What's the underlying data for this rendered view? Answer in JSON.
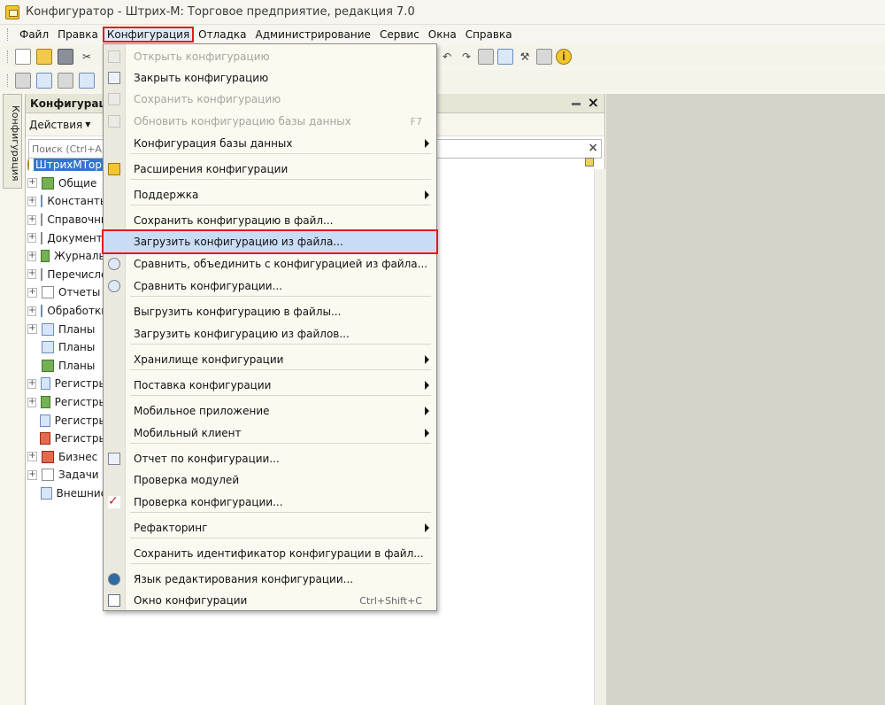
{
  "window": {
    "title": "Конфигуратор - Штрих-М: Торговое предприятие, редакция 7.0"
  },
  "menubar": {
    "items": [
      "Файл",
      "Правка",
      "Конфигурация",
      "Отладка",
      "Администрирование",
      "Сервис",
      "Окна",
      "Справка"
    ],
    "active_item": "Конфигурация"
  },
  "sidebar_tab": {
    "label": "Конфигурация"
  },
  "panel": {
    "title": "Конфигурация",
    "actions_label": "Действия",
    "search_placeholder": "Поиск (Ctrl+Alt+I)"
  },
  "tree": [
    {
      "label": "ШтрихМТорг",
      "icon": "root-config-icon",
      "selected": true
    },
    {
      "label": "Общие",
      "icon": "common-icon"
    },
    {
      "label": "Константы",
      "icon": "constants-icon"
    },
    {
      "label": "Справочники",
      "icon": "catalogs-icon"
    },
    {
      "label": "Документы",
      "icon": "documents-icon"
    },
    {
      "label": "Журналы",
      "icon": "journals-icon"
    },
    {
      "label": "Перечисления",
      "icon": "enums-icon"
    },
    {
      "label": "Отчеты",
      "icon": "reports-icon"
    },
    {
      "label": "Обработки",
      "icon": "dataprocessors-icon"
    },
    {
      "label": "Планы",
      "icon": "plans-icon"
    },
    {
      "label": "Планы",
      "icon": "plans-icon"
    },
    {
      "label": "Планы",
      "icon": "plans-icon"
    },
    {
      "label": "Регистры",
      "icon": "registers-icon"
    },
    {
      "label": "Регистры",
      "icon": "registers-icon"
    },
    {
      "label": "Регистры",
      "icon": "registers-icon"
    },
    {
      "label": "Регистры",
      "icon": "registers-icon"
    },
    {
      "label": "Бизнес",
      "icon": "business-icon"
    },
    {
      "label": "Задачи",
      "icon": "tasks-icon"
    },
    {
      "label": "Внешние",
      "icon": "external-icon"
    }
  ],
  "config_menu": {
    "items": [
      {
        "label": "Открыть конфигурацию",
        "disabled": true
      },
      {
        "label": "Закрыть конфигурацию"
      },
      {
        "label": "Сохранить конфигурацию",
        "disabled": true
      },
      {
        "label": "Обновить конфигурацию базы данных",
        "shortcut": "F7",
        "disabled": true
      },
      {
        "label": "Конфигурация базы данных",
        "submenu": true
      },
      {
        "label": "Расширения конфигурации"
      },
      {
        "label": "Поддержка",
        "submenu": true
      },
      {
        "label": "Сохранить конфигурацию в файл..."
      },
      {
        "label": "Загрузить конфигурацию из файла...",
        "highlighted": true
      },
      {
        "label": "Сравнить, объединить с конфигурацией из файла..."
      },
      {
        "label": "Сравнить конфигурации..."
      },
      {
        "label": "Выгрузить конфигурацию в файлы..."
      },
      {
        "label": "Загрузить конфигурацию из файлов..."
      },
      {
        "label": "Хранилище конфигурации",
        "submenu": true
      },
      {
        "label": "Поставка конфигурации",
        "submenu": true
      },
      {
        "label": "Мобильное приложение",
        "submenu": true
      },
      {
        "label": "Мобильный клиент",
        "submenu": true
      },
      {
        "label": "Отчет по конфигурации..."
      },
      {
        "label": "Проверка модулей"
      },
      {
        "label": "Проверка конфигурации..."
      },
      {
        "label": "Рефакторинг",
        "submenu": true
      },
      {
        "label": "Сохранить идентификатор конфигурации в файл..."
      },
      {
        "label": "Язык редактирования конфигурации..."
      },
      {
        "label": "Окно конфигурации",
        "shortcut": "Ctrl+Shift+C"
      }
    ]
  },
  "colors": {
    "highlight_outline": "#e21a1a",
    "selection": "#3376d0",
    "menu_bg": "#fbfaf1"
  }
}
